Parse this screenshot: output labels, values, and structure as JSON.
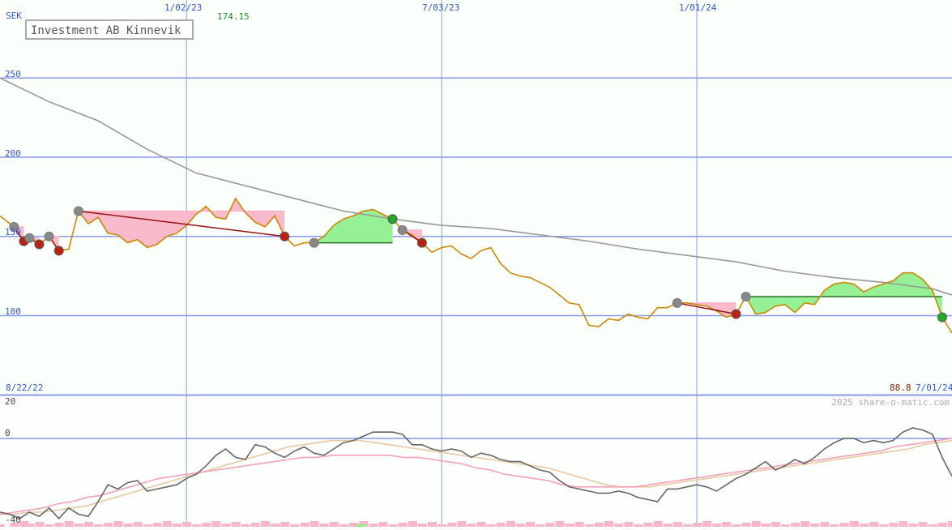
{
  "chart_data": {
    "type": "line",
    "title": "Investment AB Kinnevik",
    "currency": "SEK",
    "watermark": "2025 share-o-matic.com",
    "start_date": "8/22/22",
    "end_date": "7/01/24",
    "last_value": "88.8",
    "peak_value": "174.15",
    "x_ticks": [
      "1/02/23",
      "7/03/23",
      "1/01/24"
    ],
    "price_panel": {
      "ylim": [
        40,
        290
      ],
      "y_ticks": [
        100,
        150,
        200,
        250
      ],
      "price_series": [
        [
          "8/22/22",
          163
        ],
        [
          "9/01/22",
          156
        ],
        [
          "9/08/22",
          147
        ],
        [
          "9/12/22",
          149
        ],
        [
          "9/19/22",
          145
        ],
        [
          "9/26/22",
          150
        ],
        [
          "10/03/22",
          141
        ],
        [
          "10/10/22",
          142
        ],
        [
          "10/17/22",
          166
        ],
        [
          "10/24/22",
          158
        ],
        [
          "10/31/22",
          162
        ],
        [
          "11/07/22",
          152
        ],
        [
          "11/14/22",
          151
        ],
        [
          "11/21/22",
          146
        ],
        [
          "11/28/22",
          148
        ],
        [
          "12/05/22",
          143
        ],
        [
          "12/12/22",
          145
        ],
        [
          "12/19/22",
          150
        ],
        [
          "12/26/22",
          152
        ],
        [
          "1/02/23",
          157
        ],
        [
          "1/09/23",
          164
        ],
        [
          "1/16/23",
          169
        ],
        [
          "1/23/23",
          162
        ],
        [
          "1/30/23",
          161
        ],
        [
          "2/06/23",
          174
        ],
        [
          "2/13/23",
          165
        ],
        [
          "2/20/23",
          159
        ],
        [
          "2/27/23",
          156
        ],
        [
          "3/06/23",
          163
        ],
        [
          "3/13/23",
          150
        ],
        [
          "3/20/23",
          144
        ],
        [
          "3/27/23",
          146
        ],
        [
          "4/03/23",
          146
        ],
        [
          "4/10/23",
          150
        ],
        [
          "4/17/23",
          157
        ],
        [
          "4/24/23",
          161
        ],
        [
          "5/01/23",
          163
        ],
        [
          "5/08/23",
          166
        ],
        [
          "5/15/23",
          167
        ],
        [
          "5/22/23",
          164
        ],
        [
          "5/29/23",
          161
        ],
        [
          "6/05/23",
          154
        ],
        [
          "6/12/23",
          151
        ],
        [
          "6/19/23",
          146
        ],
        [
          "6/26/23",
          140
        ],
        [
          "7/03/23",
          143
        ],
        [
          "7/10/23",
          144
        ],
        [
          "7/17/23",
          139
        ],
        [
          "7/24/23",
          136
        ],
        [
          "7/31/23",
          141
        ],
        [
          "8/07/23",
          143
        ],
        [
          "8/14/23",
          133
        ],
        [
          "8/21/23",
          127
        ],
        [
          "8/28/23",
          125
        ],
        [
          "9/04/23",
          124
        ],
        [
          "9/11/23",
          121
        ],
        [
          "9/18/23",
          118
        ],
        [
          "9/25/23",
          113
        ],
        [
          "10/02/23",
          108
        ],
        [
          "10/09/23",
          107
        ],
        [
          "10/16/23",
          94
        ],
        [
          "10/23/23",
          93
        ],
        [
          "10/30/23",
          98
        ],
        [
          "11/06/23",
          97
        ],
        [
          "11/13/23",
          101
        ],
        [
          "11/20/23",
          99
        ],
        [
          "11/27/23",
          98
        ],
        [
          "12/04/23",
          105
        ],
        [
          "12/11/23",
          105
        ],
        [
          "12/18/23",
          108
        ],
        [
          "12/25/23",
          108
        ],
        [
          "1/01/24",
          107
        ],
        [
          "1/08/24",
          106
        ],
        [
          "1/15/24",
          103
        ],
        [
          "1/22/24",
          99
        ],
        [
          "1/29/24",
          101
        ],
        [
          "2/05/24",
          112
        ],
        [
          "2/12/24",
          101
        ],
        [
          "2/19/24",
          102
        ],
        [
          "2/26/24",
          106
        ],
        [
          "3/04/24",
          107
        ],
        [
          "3/11/24",
          102
        ],
        [
          "3/18/24",
          108
        ],
        [
          "3/25/24",
          107
        ],
        [
          "4/01/24",
          116
        ],
        [
          "4/08/24",
          120
        ],
        [
          "4/15/24",
          121
        ],
        [
          "4/22/24",
          120
        ],
        [
          "4/29/24",
          115
        ],
        [
          "5/06/24",
          118
        ],
        [
          "5/13/24",
          120
        ],
        [
          "5/20/24",
          122
        ],
        [
          "5/27/24",
          127
        ],
        [
          "6/03/24",
          127
        ],
        [
          "6/10/24",
          123
        ],
        [
          "6/17/24",
          116
        ],
        [
          "6/24/24",
          99
        ],
        [
          "7/01/24",
          89
        ]
      ],
      "moving_average_series": [
        [
          "8/22/22",
          250
        ],
        [
          "9/26/22",
          235
        ],
        [
          "10/31/22",
          223
        ],
        [
          "12/05/22",
          205
        ],
        [
          "1/09/23",
          190
        ],
        [
          "2/13/23",
          182
        ],
        [
          "3/20/23",
          174
        ],
        [
          "4/24/23",
          166
        ],
        [
          "5/29/23",
          161
        ],
        [
          "7/03/23",
          157
        ],
        [
          "8/07/23",
          155
        ],
        [
          "9/11/23",
          151
        ],
        [
          "10/16/23",
          147
        ],
        [
          "11/20/23",
          142
        ],
        [
          "12/25/23",
          138
        ],
        [
          "1/29/24",
          134
        ],
        [
          "3/04/24",
          128
        ],
        [
          "4/08/24",
          124
        ],
        [
          "5/13/24",
          121
        ],
        [
          "6/17/24",
          117
        ],
        [
          "7/01/24",
          113
        ]
      ],
      "trade_periods": [
        {
          "from": "9/01/22",
          "to": "9/08/22",
          "kind": "loss"
        },
        {
          "from": "9/12/22",
          "to": "9/19/22",
          "kind": "loss"
        },
        {
          "from": "9/26/22",
          "to": "10/03/22",
          "kind": "loss"
        },
        {
          "from": "10/17/22",
          "to": "3/13/23",
          "kind": "loss"
        },
        {
          "from": "4/03/23",
          "to": "5/29/23",
          "kind": "gain"
        },
        {
          "from": "6/05/23",
          "to": "6/19/23",
          "kind": "loss"
        },
        {
          "from": "12/18/23",
          "to": "1/29/24",
          "kind": "loss"
        },
        {
          "from": "2/05/24",
          "to": "6/24/24",
          "kind": "gain"
        }
      ]
    },
    "indicator_panel": {
      "ylim": [
        -40,
        20
      ],
      "y_ticks": [
        20,
        0,
        -40
      ],
      "fast_series": [
        -35,
        -36,
        -38,
        -35,
        -37,
        -33,
        -38,
        -33,
        -36,
        -37,
        -30,
        -22,
        -24,
        -21,
        -20,
        -25,
        -24,
        -23,
        -22,
        -19,
        -17,
        -13,
        -8,
        -5,
        -9,
        -10,
        -3,
        -4,
        -7,
        -9,
        -6,
        -4,
        -7,
        -8,
        -5,
        -2,
        -1,
        1,
        3,
        3,
        3,
        2,
        -3,
        -3,
        -5,
        -6,
        -5,
        -6,
        -9,
        -7,
        -8,
        -10,
        -11,
        -11,
        -13,
        -15,
        -16,
        -20,
        -23,
        -24,
        -25,
        -26,
        -26,
        -25,
        -26,
        -28,
        -29,
        -30,
        -24,
        -24,
        -23,
        -22,
        -23,
        -25,
        -22,
        -19,
        -17,
        -14,
        -11,
        -15,
        -13,
        -10,
        -12,
        -9,
        -5,
        -2,
        0,
        0,
        -2,
        -1,
        -2,
        -1,
        3,
        5,
        4,
        2,
        -9,
        -18
      ],
      "slow_series_1": [
        -36,
        -35,
        -34,
        -33,
        -31,
        -30,
        -28,
        -27,
        -25,
        -23,
        -21,
        -19,
        -18,
        -17,
        -16,
        -15,
        -14,
        -13,
        -12,
        -11,
        -10,
        -9,
        -9,
        -8,
        -8,
        -8,
        -8,
        -8,
        -9,
        -9,
        -10,
        -11,
        -12,
        -14,
        -15,
        -17,
        -18,
        -19,
        -20,
        -22,
        -23,
        -23,
        -23,
        -23,
        -23,
        -22,
        -21,
        -20,
        -19,
        -18,
        -17,
        -16,
        -15,
        -14,
        -13,
        -12,
        -11,
        -10,
        -9,
        -8,
        -7,
        -6,
        -4,
        -3,
        -2,
        -1,
        0
      ],
      "slow_series_2": [
        -36,
        -36,
        -35,
        -35,
        -34,
        -33,
        -32,
        -30,
        -28,
        -26,
        -24,
        -22,
        -20,
        -18,
        -16,
        -14,
        -12,
        -10,
        -8,
        -6,
        -4,
        -3,
        -2,
        -1,
        -1,
        -1,
        -2,
        -3,
        -4,
        -5,
        -6,
        -7,
        -8,
        -9,
        -10,
        -11,
        -12,
        -13,
        -14,
        -16,
        -18,
        -20,
        -22,
        -23,
        -23,
        -23,
        -22,
        -21,
        -20,
        -19,
        -18,
        -17,
        -16,
        -15,
        -14,
        -13,
        -12,
        -11,
        -10,
        -9,
        -8,
        -7,
        -6,
        -5,
        -3,
        -2,
        -1
      ],
      "volume_bars": "loss"
    },
    "colors": {
      "price": "#cc8800",
      "moving_average": "#999999",
      "gain_fill": "#90f090",
      "loss_fill": "#f9b6c8",
      "grid": "#8899ee",
      "axis_label": "#3355cc",
      "peak_label": "#228822",
      "last_label": "#882200",
      "fast_line": "#666666",
      "slow_line_1": "#f4a0b8",
      "slow_line_2": "#e8c8a0",
      "buy_marker": "#888888",
      "sell_loss_marker": "#bb2211",
      "sell_gain_marker": "#22aa22"
    }
  }
}
